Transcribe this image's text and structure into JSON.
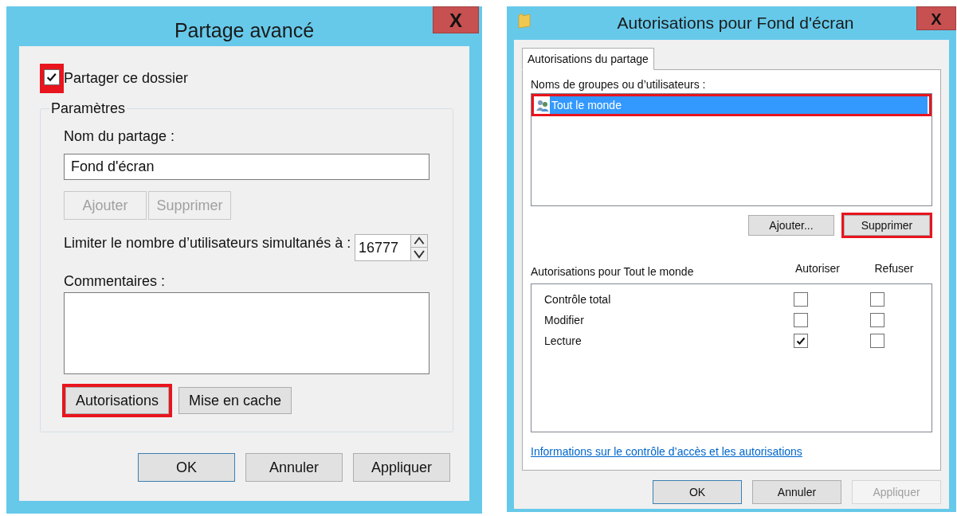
{
  "left_dialog": {
    "title": "Partage avancé",
    "close": "X",
    "share_checkbox": {
      "label": "Partager ce dossier",
      "checked": true,
      "highlighted": true
    },
    "group": {
      "title": "Paramètres",
      "share_name_label": "Nom du partage :",
      "share_name_value": "Fond d'écran",
      "name_buttons": [
        {
          "label": "Ajouter",
          "disabled": true
        },
        {
          "label": "Supprimer",
          "disabled": true
        }
      ],
      "limit_label": "Limiter le nombre d’utilisateurs simultanés à :",
      "limit_value": "16777",
      "comments_label": "Commentaires :",
      "buttons": [
        {
          "label": "Autorisations",
          "highlighted": true
        },
        {
          "label": "Mise en cache",
          "highlighted": false
        }
      ]
    },
    "footer_buttons": [
      {
        "label": "OK",
        "default": true,
        "disabled": false
      },
      {
        "label": "Annuler",
        "default": false,
        "disabled": false
      },
      {
        "label": "Appliquer",
        "default": false,
        "disabled": false
      }
    ]
  },
  "right_dialog": {
    "title": "Autorisations pour Fond d'écran",
    "close": "X",
    "tabs": [
      {
        "label": "Autorisations du partage",
        "selected": true
      }
    ],
    "users_label": "Noms de groupes ou d’utilisateurs :",
    "users": [
      {
        "name": "Tout le monde",
        "selected": true,
        "highlighted": true
      }
    ],
    "user_buttons": [
      {
        "label": "Ajouter...",
        "highlighted": false
      },
      {
        "label": "Supprimer",
        "highlighted": true
      }
    ],
    "permissions_label": "Autorisations pour Tout le monde",
    "columns": [
      "Autoriser",
      "Refuser"
    ],
    "permissions": [
      {
        "name": "Contrôle total",
        "allow": false,
        "deny": false
      },
      {
        "name": "Modifier",
        "allow": false,
        "deny": false
      },
      {
        "name": "Lecture",
        "allow": true,
        "deny": false
      }
    ],
    "link": "Informations sur le contrôle d’accès et les autorisations",
    "footer_buttons": [
      {
        "label": "OK",
        "default": true,
        "disabled": false
      },
      {
        "label": "Annuler",
        "default": false,
        "disabled": false
      },
      {
        "label": "Appliquer",
        "default": false,
        "disabled": true
      }
    ]
  }
}
